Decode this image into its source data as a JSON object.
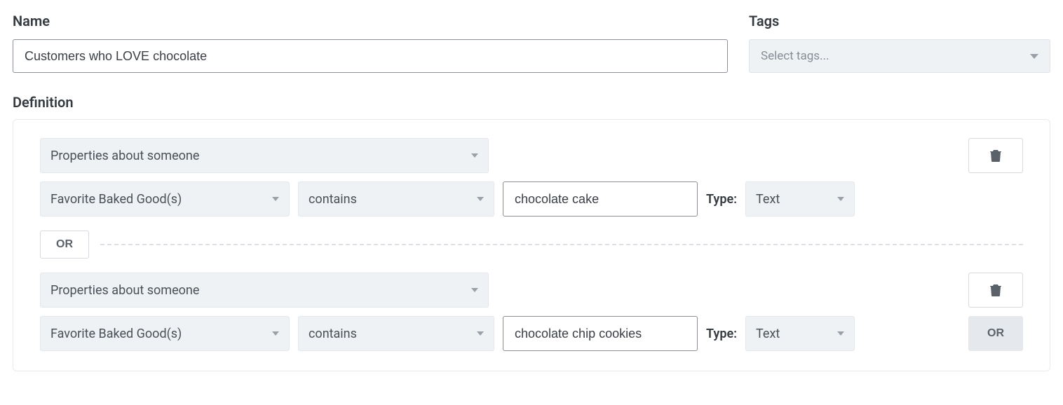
{
  "labels": {
    "name": "Name",
    "tags": "Tags",
    "definition": "Definition",
    "type": "Type:",
    "or": "OR"
  },
  "form": {
    "name_value": "Customers who LOVE chocolate",
    "tags_placeholder": "Select tags..."
  },
  "rules": [
    {
      "category": "Properties about someone",
      "field": "Favorite Baked Good(s)",
      "operator": "contains",
      "value": "chocolate cake",
      "value_type": "Text"
    },
    {
      "category": "Properties about someone",
      "field": "Favorite Baked Good(s)",
      "operator": "contains",
      "value": "chocolate chip cookies",
      "value_type": "Text"
    }
  ]
}
